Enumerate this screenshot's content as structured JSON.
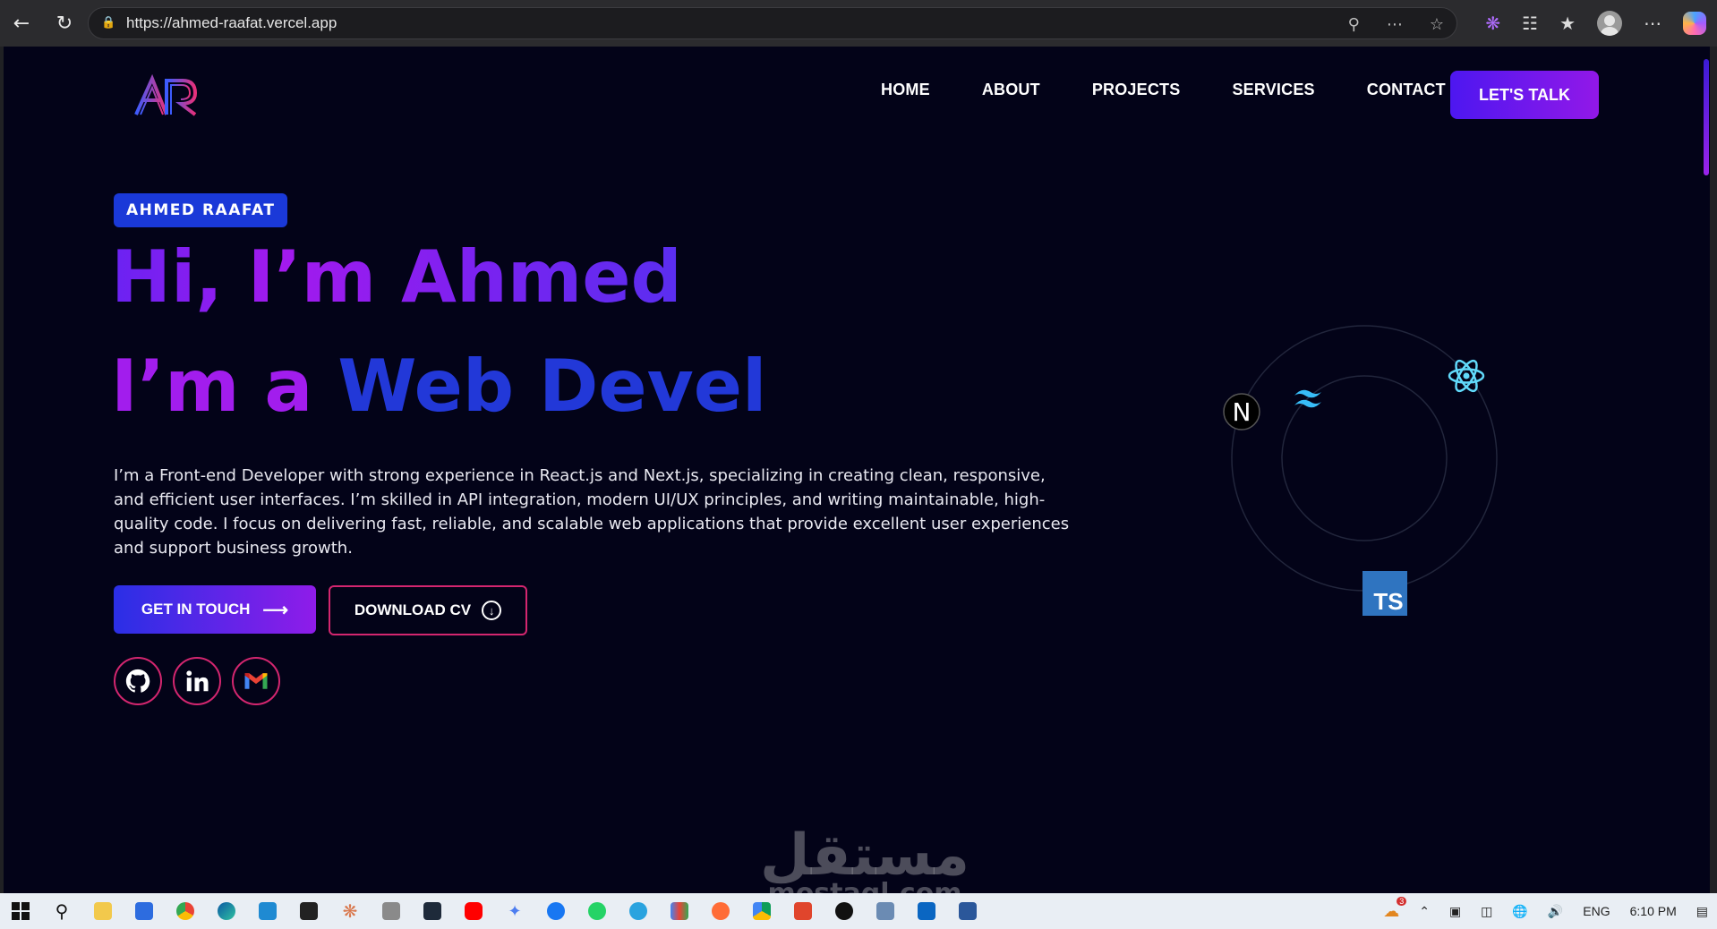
{
  "browser": {
    "url": "https://ahmed-raafat.vercel.app"
  },
  "nav": {
    "items": [
      "HOME",
      "ABOUT",
      "PROJECTS",
      "SERVICES",
      "CONTACT"
    ],
    "cta": "LET'S TALK"
  },
  "hero": {
    "badge": "AHMED RAAFAT",
    "line1": "Hi, I’m Ahmed",
    "line2_prefix": "I’m a ",
    "line2_typed": "Web Devel",
    "description": "I’m a Front-end Developer with strong experience in React.js and Next.js, specializing in creating clean, responsive, and efficient user interfaces. I’m skilled in API integration, modern UI/UX principles, and writing maintainable, high-quality code. I focus on delivering fast, reliable, and scalable web applications that provide excellent user experiences and support business growth.",
    "primary_button": "GET IN TOUCH",
    "secondary_button": "DOWNLOAD CV"
  },
  "orbit": {
    "nextjs_glyph": "N",
    "typescript_label": "TS"
  },
  "watermark": {
    "arabic": "مستقل",
    "latin": "mostaql.com"
  },
  "taskbar": {
    "weather_badge": "3",
    "language": "ENG",
    "time": "6:10 PM"
  },
  "colors": {
    "page_bg": "#030318",
    "accent_purple": "#9218e8",
    "accent_blue": "#2238d8",
    "social_border": "#d3266f"
  }
}
